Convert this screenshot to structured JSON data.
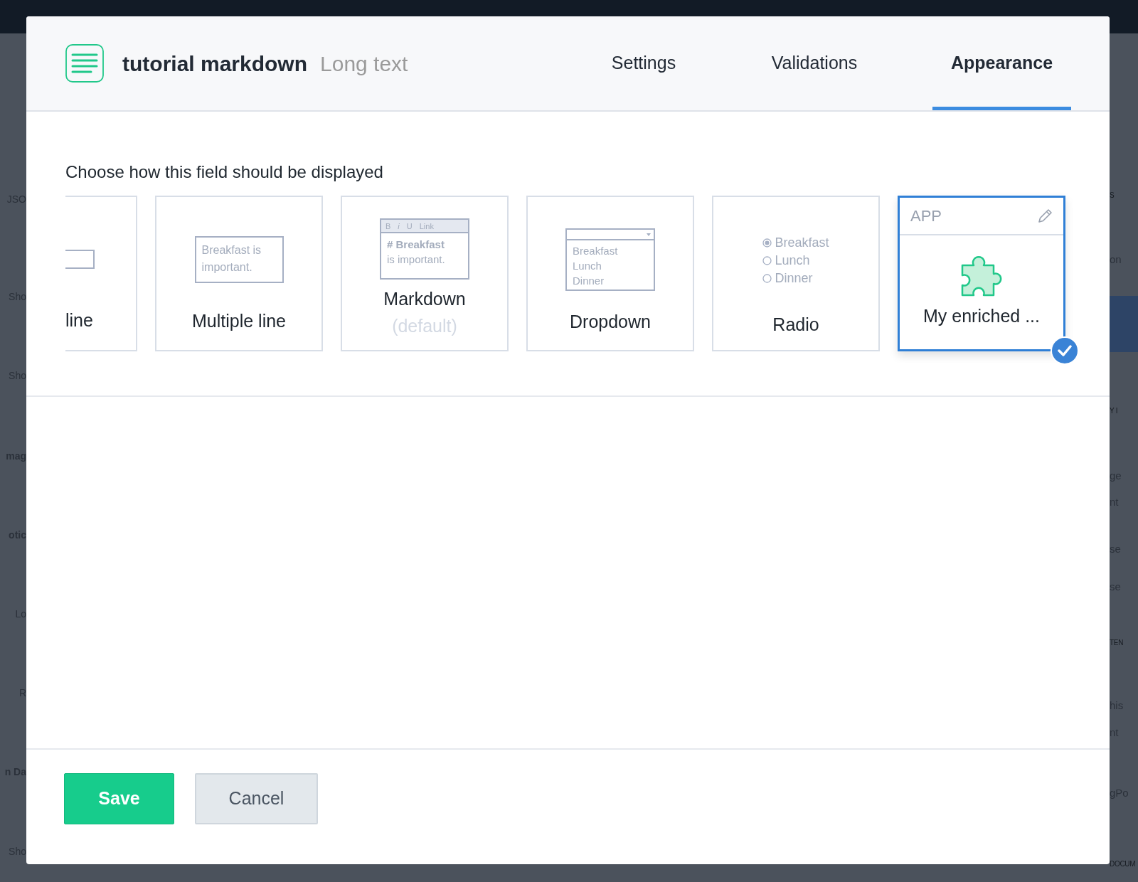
{
  "backdrop": {
    "left_fragments": [
      {
        "text": "JSO",
        "bold": false
      },
      {
        "text": "Sho",
        "bold": false
      },
      {
        "text": "Sho",
        "bold": false
      },
      {
        "text": "mag",
        "bold": true
      },
      {
        "text": "otic",
        "bold": true
      },
      {
        "text": "Lo",
        "bold": false
      },
      {
        "text": "R",
        "bold": false
      },
      {
        "text": "n Da",
        "bold": true
      },
      {
        "text": "Sho",
        "bold": false
      }
    ],
    "right_fragments": [
      {
        "text": "S",
        "kind": "heading"
      },
      {
        "text": "on",
        "kind": "text"
      },
      {
        "kind": "highlight"
      },
      {
        "text": "Y I",
        "kind": "heading"
      },
      {
        "text": "ge",
        "kind": "text"
      },
      {
        "text": "nt",
        "kind": "text"
      },
      {
        "text": "se",
        "kind": "text"
      },
      {
        "text": "se",
        "kind": "text"
      },
      {
        "text": "TEN",
        "kind": "heading"
      },
      {
        "text": "his",
        "kind": "text"
      },
      {
        "text": "nt",
        "kind": "text"
      },
      {
        "text": "gPo",
        "kind": "text"
      },
      {
        "text": "DOCUM",
        "kind": "heading"
      }
    ]
  },
  "modal": {
    "title": "tutorial markdown",
    "subtitle": "Long text",
    "tabs": [
      {
        "label": "Settings",
        "selected": false
      },
      {
        "label": "Validations",
        "selected": false
      },
      {
        "label": "Appearance",
        "selected": true
      }
    ],
    "prompt": "Choose how this field should be displayed",
    "options": [
      {
        "kind": "single",
        "label": "line",
        "selected": false
      },
      {
        "kind": "multiline",
        "label": "Multiple line",
        "preview": "Breakfast is important.",
        "selected": false
      },
      {
        "kind": "markdown",
        "label": "Markdown",
        "note": "(default)",
        "toolbar": [
          "B",
          "i",
          "U",
          "Link"
        ],
        "heading": "# Breakfast",
        "body": "is important.",
        "selected": false
      },
      {
        "kind": "dropdown",
        "label": "Dropdown",
        "items": [
          "Breakfast",
          "Lunch",
          "Dinner"
        ],
        "selected": false
      },
      {
        "kind": "radio",
        "label": "Radio",
        "items": [
          {
            "label": "Breakfast",
            "selected": true
          },
          {
            "label": "Lunch",
            "selected": false
          },
          {
            "label": "Dinner",
            "selected": false
          }
        ],
        "selected": false
      },
      {
        "kind": "app",
        "badge": "APP",
        "label": "My enriched ...",
        "selected": true
      }
    ],
    "buttons": [
      {
        "label": "Save",
        "kind": "primary"
      },
      {
        "label": "Cancel",
        "kind": "secondary"
      }
    ]
  }
}
